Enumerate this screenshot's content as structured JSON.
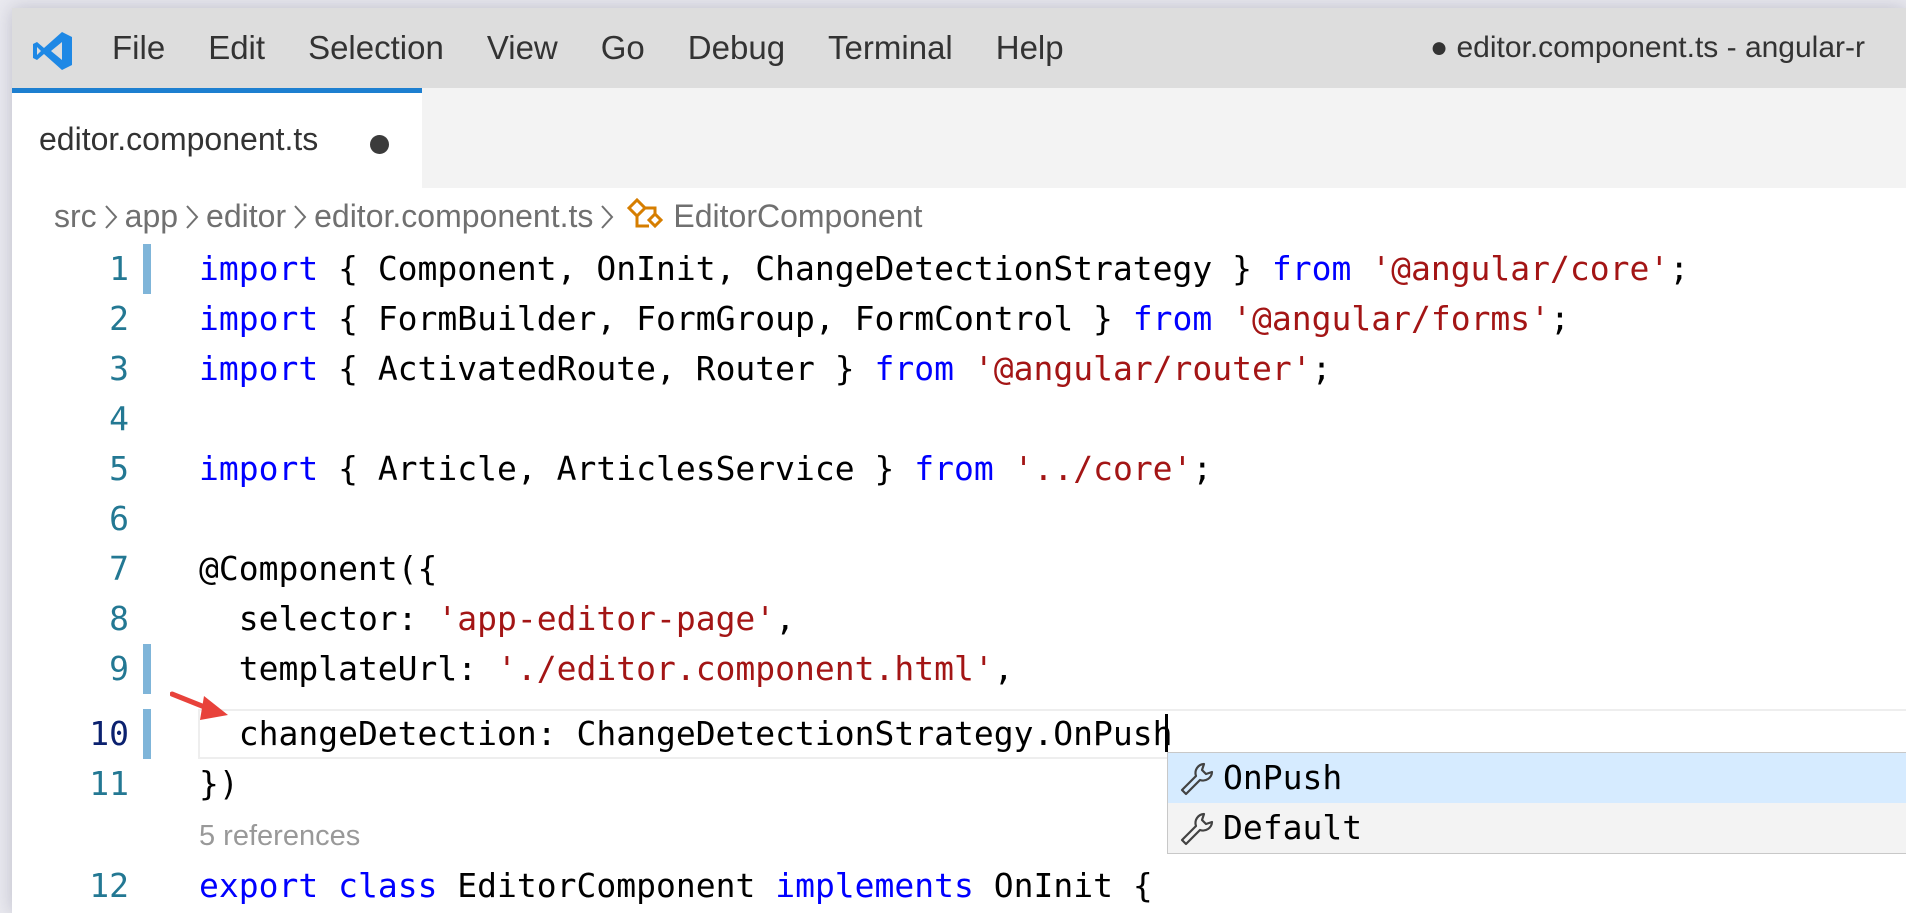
{
  "app": {
    "window_title": "● editor.component.ts - angular-r",
    "logo_icon": "vscode-logo-icon",
    "accent_color": "#1d7fd0"
  },
  "menu": [
    "File",
    "Edit",
    "Selection",
    "View",
    "Go",
    "Debug",
    "Terminal",
    "Help"
  ],
  "tab": {
    "label": "editor.component.ts",
    "dirty_indicator": "●"
  },
  "breadcrumb": [
    "src",
    "app",
    "editor",
    "editor.component.ts",
    "EditorComponent"
  ],
  "editor": {
    "lines": [
      {
        "n": "1",
        "tokens": [
          [
            "kw",
            "import"
          ],
          [
            "",
            "{ Component, OnInit, ChangeDetectionStrategy } "
          ],
          [
            "kw",
            "from"
          ],
          [
            "",
            " "
          ],
          [
            "str",
            "'@angular/core'"
          ],
          [
            "",
            ";"
          ]
        ]
      },
      {
        "n": "2",
        "tokens": [
          [
            "kw",
            "import"
          ],
          [
            "",
            "{ FormBuilder, FormGroup, FormControl } "
          ],
          [
            "kw",
            "from"
          ],
          [
            "",
            " "
          ],
          [
            "str",
            "'@angular/forms'"
          ],
          [
            "",
            ";"
          ]
        ]
      },
      {
        "n": "3",
        "tokens": [
          [
            "kw",
            "import"
          ],
          [
            "",
            "{ ActivatedRoute, Router } "
          ],
          [
            "kw",
            "from"
          ],
          [
            "",
            " "
          ],
          [
            "str",
            "'@angular/router'"
          ],
          [
            "",
            ";"
          ]
        ]
      },
      {
        "n": "4",
        "tokens": []
      },
      {
        "n": "5",
        "tokens": [
          [
            "kw",
            "import"
          ],
          [
            "",
            "{ Article, ArticlesService } "
          ],
          [
            "kw",
            "from"
          ],
          [
            "",
            " "
          ],
          [
            "str",
            "'../core'"
          ],
          [
            "",
            ";"
          ]
        ]
      },
      {
        "n": "6",
        "tokens": []
      },
      {
        "n": "7",
        "tokens": [
          [
            "",
            "@Component({"
          ]
        ]
      },
      {
        "n": "8",
        "tokens": [
          [
            "",
            "  selector: "
          ],
          [
            "str",
            "'app-editor-page'"
          ],
          [
            "",
            ","
          ]
        ]
      },
      {
        "n": "9",
        "tokens": [
          [
            "",
            "  templateUrl: "
          ],
          [
            "str",
            "'./editor.component.html'"
          ],
          [
            "",
            ","
          ]
        ]
      },
      {
        "n": "10",
        "tokens": [
          [
            "",
            "  changeDetection: ChangeDetectionStrategy.OnPush"
          ]
        ]
      },
      {
        "n": "11",
        "tokens": [
          [
            "",
            "})"
          ]
        ]
      },
      {
        "n": "12",
        "tokens": [
          [
            "kw",
            "export"
          ],
          [
            "",
            " "
          ],
          [
            "kw",
            "class"
          ],
          [
            "",
            " EditorComponent "
          ],
          [
            "kw",
            "implements"
          ],
          [
            "",
            " OnInit {"
          ]
        ]
      }
    ],
    "codelens": "5 references",
    "active_line": "10"
  },
  "suggest": {
    "items": [
      {
        "label": "OnPush",
        "icon": "wrench-icon",
        "selected": true
      },
      {
        "label": "Default",
        "icon": "wrench-icon",
        "selected": false
      }
    ]
  }
}
